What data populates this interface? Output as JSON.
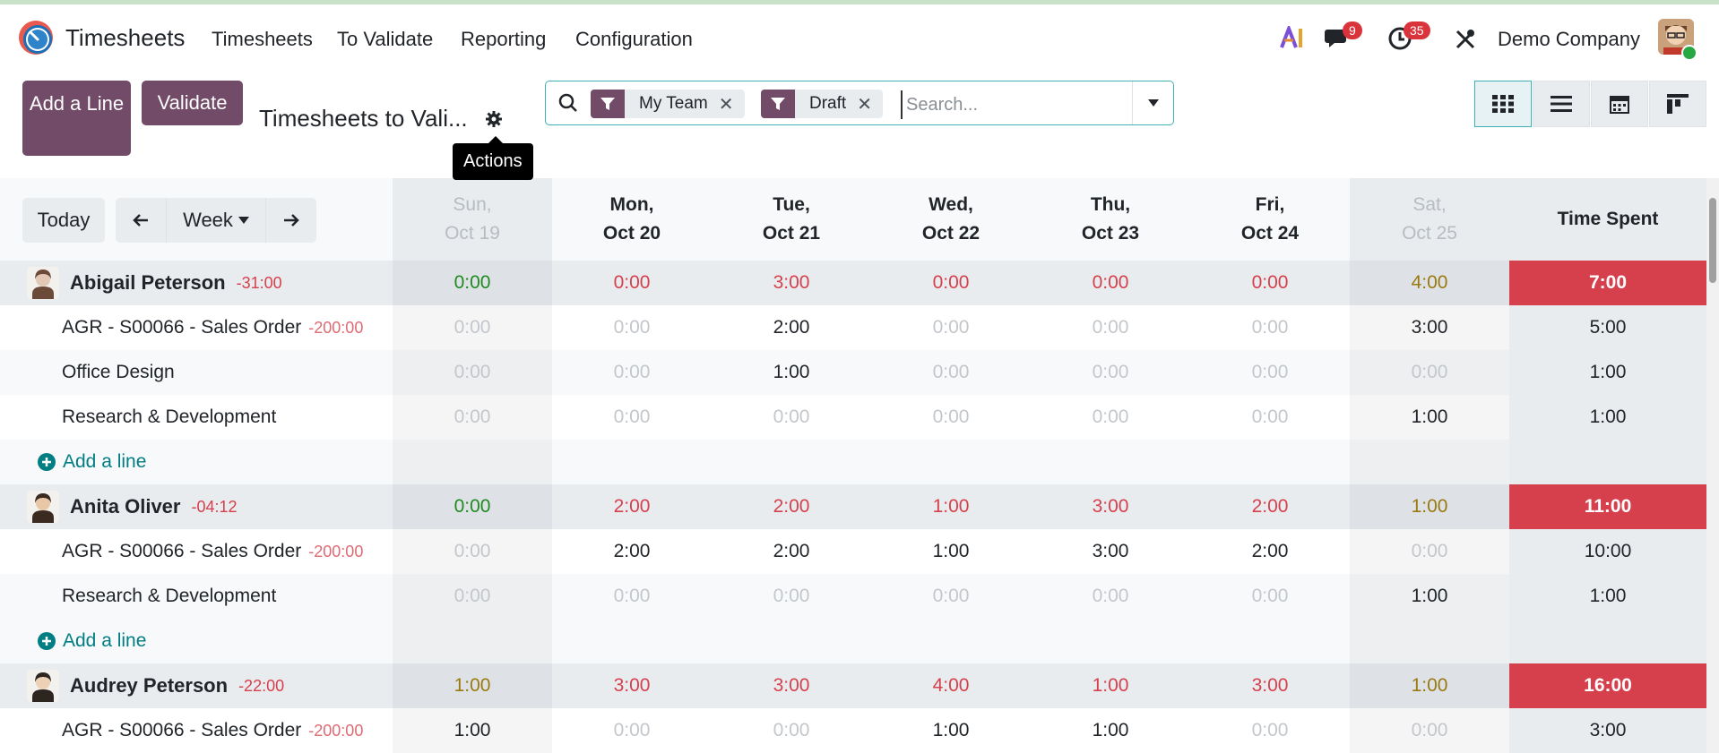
{
  "app": {
    "title": "Timesheets"
  },
  "menu": [
    {
      "label": "Timesheets"
    },
    {
      "label": "To Validate"
    },
    {
      "label": "Reporting"
    },
    {
      "label": "Configuration"
    }
  ],
  "systray": {
    "messages_count": "9",
    "activities_count": "35",
    "company": "Demo Company"
  },
  "control_panel": {
    "add_line_label": "Add a Line",
    "validate_label": "Validate",
    "breadcrumb": "Timesheets to Vali...",
    "actions_tooltip": "Actions"
  },
  "search": {
    "facets": [
      {
        "label": "My Team"
      },
      {
        "label": "Draft"
      }
    ],
    "placeholder": "Search..."
  },
  "grid": {
    "today_label": "Today",
    "period_label": "Week",
    "columns": [
      {
        "day": "Sun,",
        "date": "Oct 19",
        "weekend": true
      },
      {
        "day": "Mon,",
        "date": "Oct 20",
        "weekend": false
      },
      {
        "day": "Tue,",
        "date": "Oct 21",
        "weekend": false
      },
      {
        "day": "Wed,",
        "date": "Oct 22",
        "weekend": false
      },
      {
        "day": "Thu,",
        "date": "Oct 23",
        "weekend": false
      },
      {
        "day": "Fri,",
        "date": "Oct 24",
        "weekend": false
      },
      {
        "day": "Sat,",
        "date": "Oct 25",
        "weekend": true
      }
    ],
    "total_label": "Time Spent",
    "add_line_label": "Add a line",
    "groups": [
      {
        "employee": "Abigail Peterson",
        "balance": "-31:00",
        "days": [
          "0:00",
          "0:00",
          "3:00",
          "0:00",
          "0:00",
          "0:00",
          "4:00"
        ],
        "total": "7:00",
        "lines": [
          {
            "name": "AGR - S00066 - Sales Order",
            "balance": "-200:00",
            "days": [
              "0:00",
              "0:00",
              "2:00",
              "0:00",
              "0:00",
              "0:00",
              "3:00"
            ],
            "total": "5:00"
          },
          {
            "name": "Office Design",
            "balance": "",
            "days": [
              "0:00",
              "0:00",
              "1:00",
              "0:00",
              "0:00",
              "0:00",
              "0:00"
            ],
            "total": "1:00"
          },
          {
            "name": "Research & Development",
            "balance": "",
            "days": [
              "0:00",
              "0:00",
              "0:00",
              "0:00",
              "0:00",
              "0:00",
              "1:00"
            ],
            "total": "1:00"
          }
        ]
      },
      {
        "employee": "Anita Oliver",
        "balance": "-04:12",
        "days": [
          "0:00",
          "2:00",
          "2:00",
          "1:00",
          "3:00",
          "2:00",
          "1:00"
        ],
        "total": "11:00",
        "lines": [
          {
            "name": "AGR - S00066 - Sales Order",
            "balance": "-200:00",
            "days": [
              "0:00",
              "2:00",
              "2:00",
              "1:00",
              "3:00",
              "2:00",
              "0:00"
            ],
            "total": "10:00"
          },
          {
            "name": "Research & Development",
            "balance": "",
            "days": [
              "0:00",
              "0:00",
              "0:00",
              "0:00",
              "0:00",
              "0:00",
              "1:00"
            ],
            "total": "1:00"
          }
        ]
      },
      {
        "employee": "Audrey Peterson",
        "balance": "-22:00",
        "days": [
          "1:00",
          "3:00",
          "3:00",
          "4:00",
          "1:00",
          "3:00",
          "1:00"
        ],
        "total": "16:00",
        "lines": [
          {
            "name": "AGR - S00066 - Sales Order",
            "balance": "-200:00",
            "days": [
              "1:00",
              "0:00",
              "0:00",
              "1:00",
              "1:00",
              "0:00",
              "0:00"
            ],
            "total": "3:00"
          }
        ]
      }
    ]
  },
  "colors": {
    "brand": "#714b67",
    "accent": "#017e84",
    "overtime": "#d6404c",
    "on_target": "#1f8a1f",
    "weekend_value": "#9a7a10"
  }
}
